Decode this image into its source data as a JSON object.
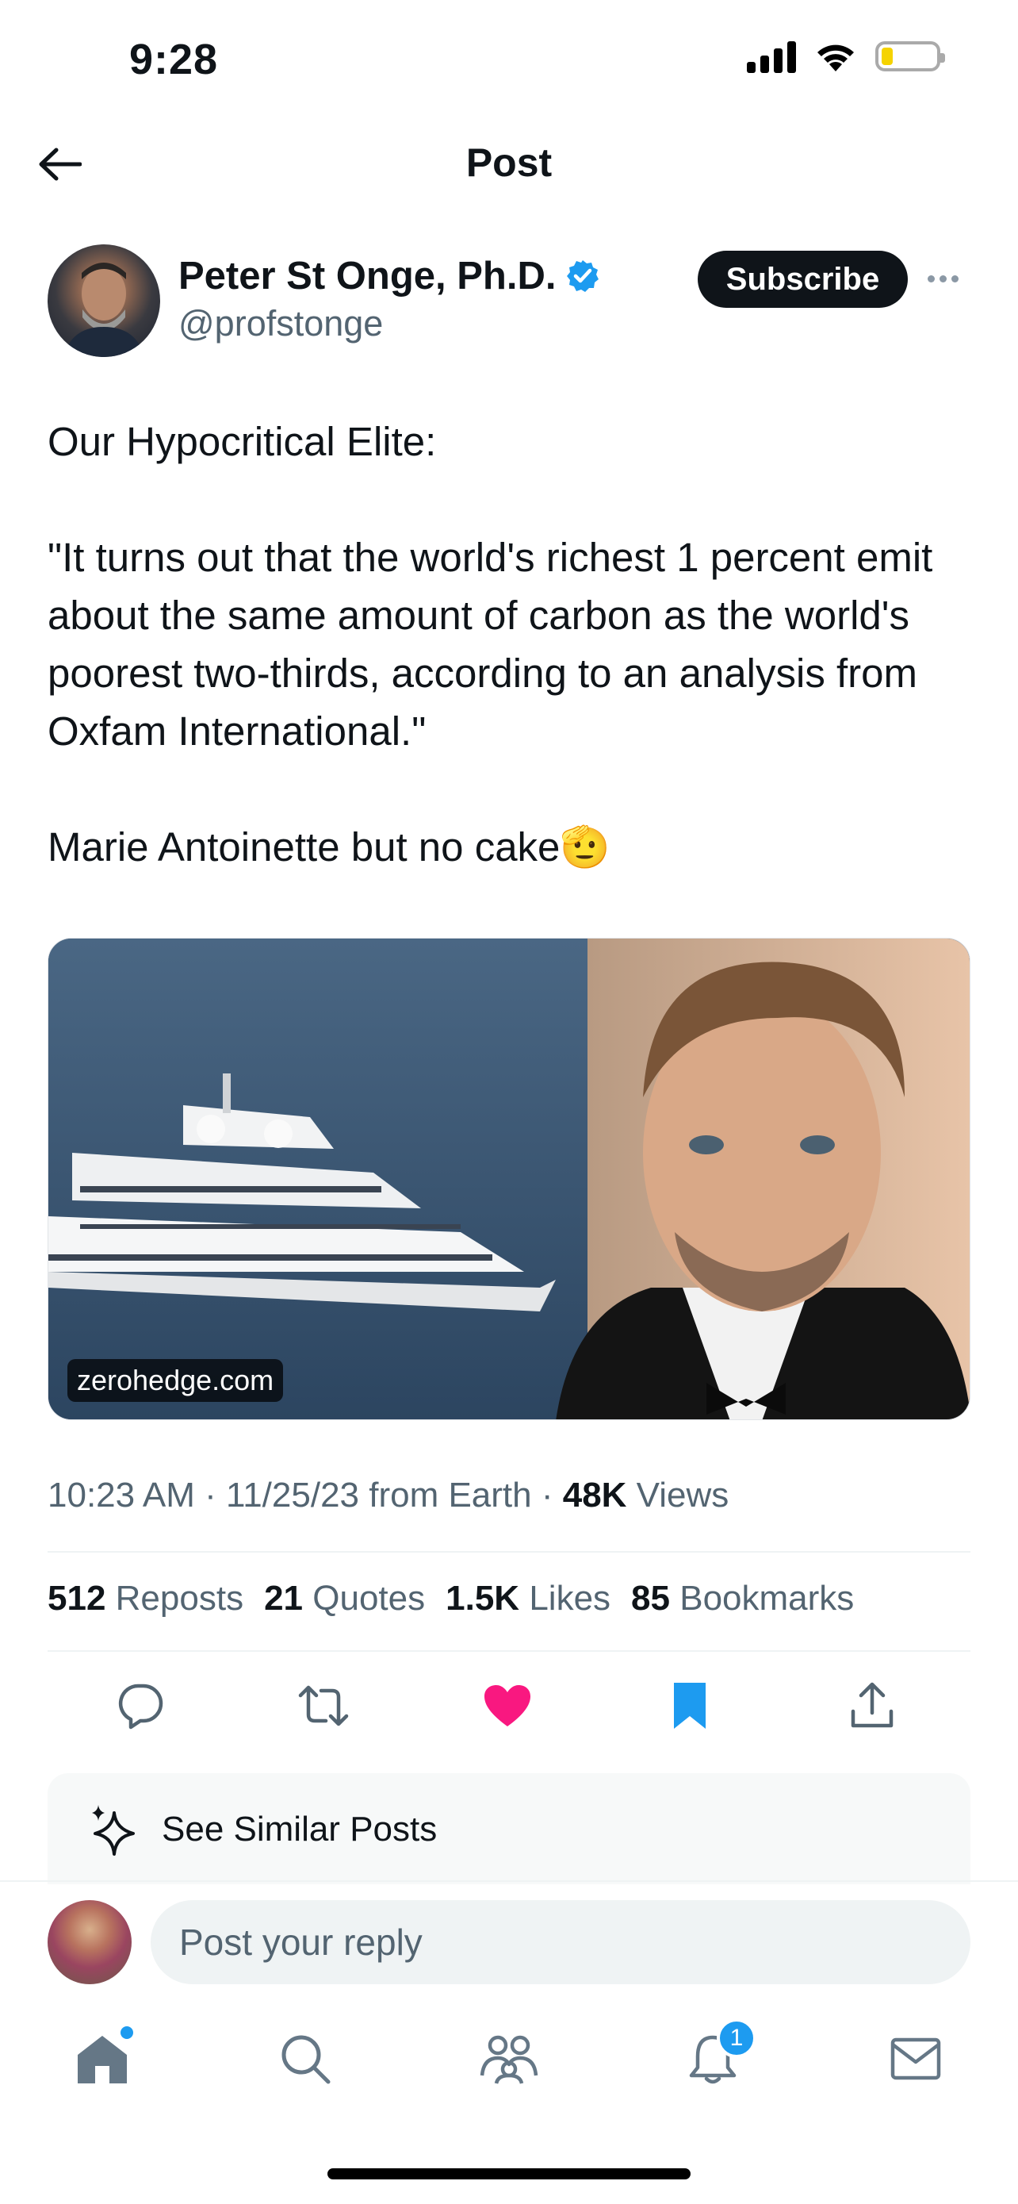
{
  "status_bar": {
    "time": "9:28"
  },
  "header": {
    "title": "Post"
  },
  "author": {
    "name": "Peter St Onge, Ph.D.",
    "handle": "@profstonge",
    "subscribe_label": "Subscribe"
  },
  "post": {
    "line1": "Our Hypocritical Elite:",
    "quote": "\"It turns out that the world's richest 1 percent emit about the same amount of carbon as the world's poorest two-thirds, according to an analysis from  Oxfam International.\"",
    "closing": "Marie Antoinette but no cake🫡",
    "media_source": "zerohedge.com",
    "meta_time": "10:23 AM · 11/25/23 from Earth · ",
    "views_count": "48K",
    "views_label": " Views"
  },
  "stats": {
    "reposts_count": "512",
    "reposts_label": "Reposts",
    "quotes_count": "21",
    "quotes_label": "Quotes",
    "likes_count": "1.5K",
    "likes_label": "Likes",
    "bookmarks_count": "85",
    "bookmarks_label": "Bookmarks"
  },
  "actions": {
    "icons": [
      "reply-icon",
      "repost-icon",
      "like-icon",
      "bookmark-icon",
      "share-icon"
    ],
    "like_color": "#f91880",
    "bookmark_color": "#1d9bf0"
  },
  "similar": {
    "label": "See Similar Posts"
  },
  "reply": {
    "placeholder": "Post your reply"
  },
  "bottom_nav": {
    "items": [
      "home-icon",
      "search-icon",
      "communities-icon",
      "notifications-icon",
      "messages-icon"
    ],
    "notification_count": "1"
  },
  "colors": {
    "accent": "#1d9bf0",
    "text": "#0f1419",
    "secondary": "#536471"
  }
}
